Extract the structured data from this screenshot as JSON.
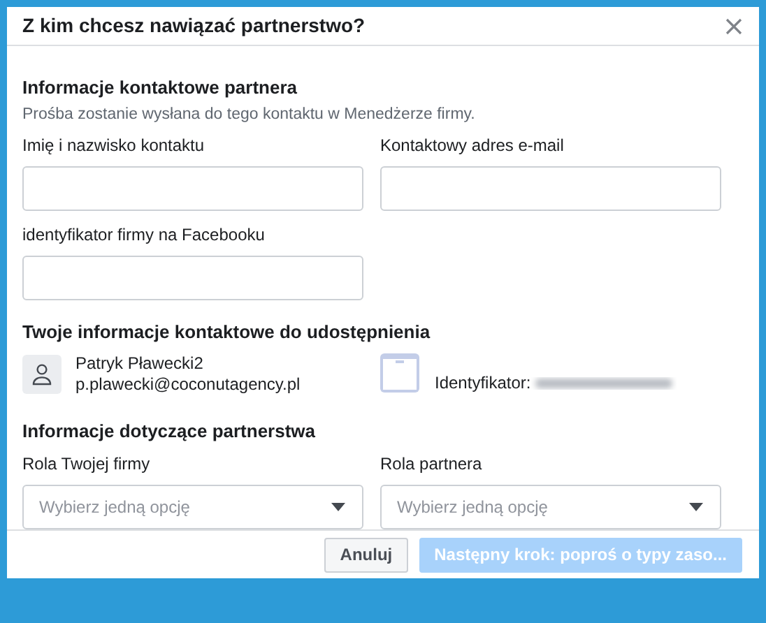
{
  "dialog": {
    "title": "Z kim chcesz nawiązać partnerstwo?"
  },
  "partner_contact": {
    "heading": "Informacje kontaktowe partnera",
    "description": "Prośba zostanie wysłana do tego kontaktu w Menedżerze firmy.",
    "fields": [
      {
        "label": "Imię i nazwisko kontaktu"
      },
      {
        "label": "Kontaktowy adres e-mail"
      },
      {
        "label": "identyfikator firmy na Facebooku"
      }
    ]
  },
  "your_contact": {
    "heading": "Twoje informacje kontaktowe do udostępnienia",
    "name": "Patryk Pławecki2",
    "email": "p.plawecki@coconutagency.pl",
    "business_id_label": "Identyfikator:"
  },
  "partnership": {
    "heading": "Informacje dotyczące partnerstwa",
    "selects": [
      {
        "label": "Rola Twojej firmy",
        "placeholder": "Wybierz jedną opcję"
      },
      {
        "label": "Rola partnera",
        "placeholder": "Wybierz jedną opcję"
      }
    ]
  },
  "buttons": [
    {
      "label": "Anuluj",
      "kind": "secondary",
      "disabled": false
    },
    {
      "label": "Następny krok: poproś o typy zaso...",
      "kind": "primary",
      "disabled": true
    }
  ]
}
